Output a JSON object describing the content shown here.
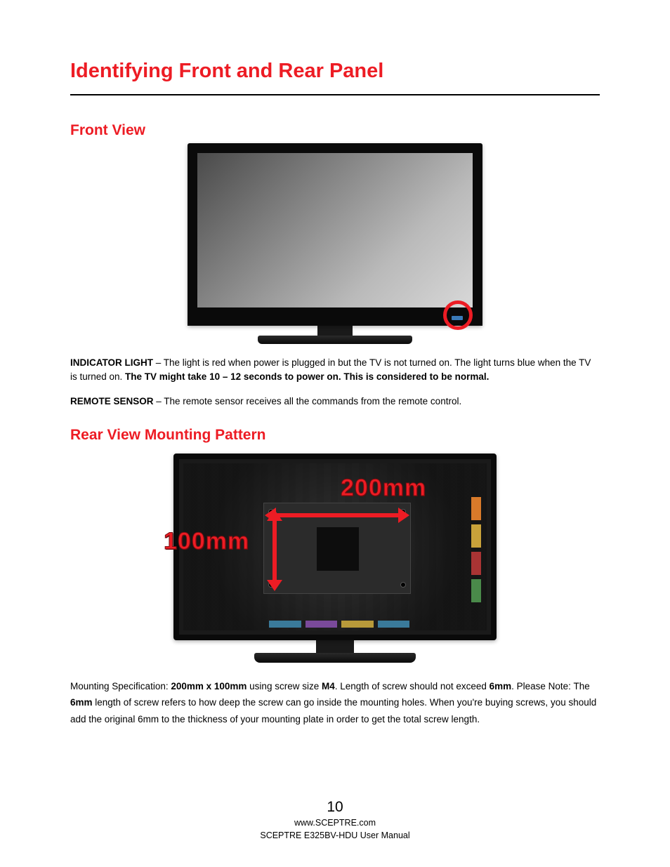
{
  "title": "Identifying Front and Rear Panel",
  "sections": {
    "front": {
      "heading": "Front View",
      "indicator": {
        "label": "INDICATOR LIGHT",
        "text_before_bold": " – The light is red when power is plugged in but the TV is not turned on.  The light turns blue when the TV is turned on. ",
        "bold_text": "The TV might take 10 – 12 seconds to power on. This is considered to be normal."
      },
      "remote": {
        "label": "REMOTE SENSOR",
        "text": " – The remote sensor receives all the commands from the remote control."
      }
    },
    "rear": {
      "heading": "Rear View Mounting Pattern",
      "dim_h": "200mm",
      "dim_v": "100mm",
      "spec": {
        "prefix": "Mounting Specification: ",
        "dims": "200mm x 100mm",
        "mid1": " using screw size ",
        "screw": "M4",
        "mid2": ". Length of screw should not exceed ",
        "len1": "6mm",
        "mid3": ".  Please Note: The ",
        "len2": "6mm",
        "suffix": " length of screw refers to how deep the screw can go inside the mounting holes.  When you're buying screws, you should add the original 6mm to the thickness of your mounting plate in order to get the total screw length."
      }
    }
  },
  "footer": {
    "page": "10",
    "url": "www.SCEPTRE.com",
    "manual": "SCEPTRE E325BV-HDU User Manual"
  }
}
